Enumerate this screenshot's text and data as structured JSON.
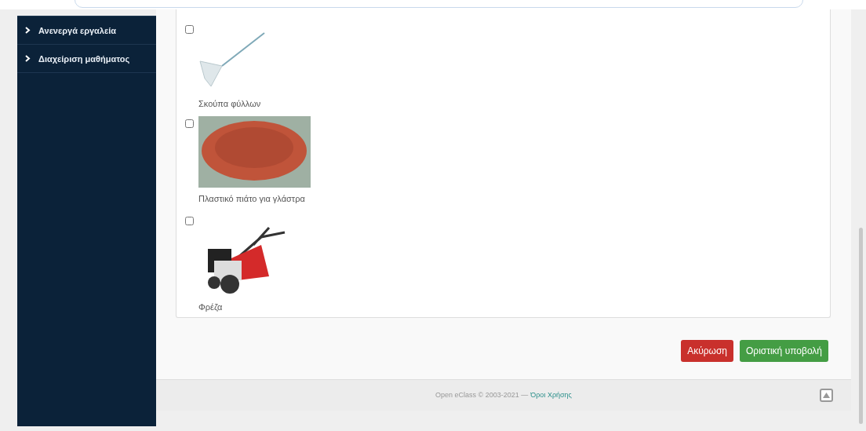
{
  "sidebar": {
    "items": [
      {
        "label": "Ανενεργά εργαλεία",
        "expanded": false
      },
      {
        "label": "Διαχείριση μαθήματος",
        "expanded": false
      }
    ]
  },
  "options": [
    {
      "kind": "rake",
      "caption": "Σκούπα φύλλων",
      "checked": false
    },
    {
      "kind": "plate",
      "caption": "Πλαστικό πιάτο για γλάστρα",
      "checked": false
    },
    {
      "kind": "tiller",
      "caption": "Φρέζα",
      "checked": false
    }
  ],
  "buttons": [
    {
      "label": "Ακύρωση",
      "kind": "danger"
    },
    {
      "label": "Οριστική υποβολή",
      "kind": "success"
    }
  ],
  "footer": {
    "text": "Open eClass © 2003-2021 —",
    "link": "Όροι Χρήσης"
  }
}
